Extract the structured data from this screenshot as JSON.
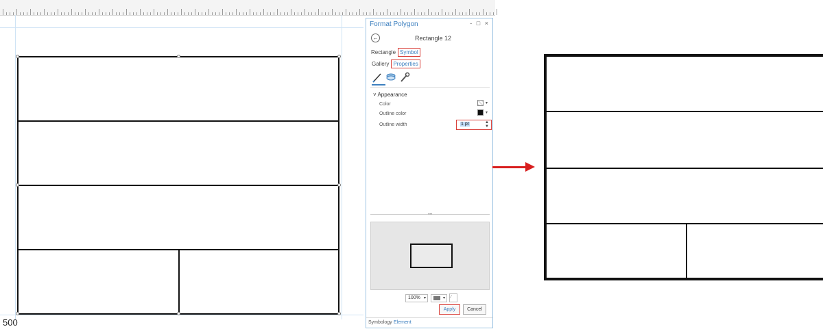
{
  "ruler": {
    "numbers": [
      "",
      "",
      "",
      "",
      "",
      "",
      "",
      "",
      "",
      "",
      "",
      "",
      "",
      "",
      "",
      "",
      "",
      "",
      "",
      "",
      "",
      "",
      "",
      "",
      "",
      "",
      "",
      "",
      "",
      "",
      "",
      "",
      "",
      "",
      "",
      "",
      "",
      ""
    ]
  },
  "layout_view": {
    "scale_label": "500"
  },
  "format_panel": {
    "title": "Format Polygon",
    "window_controls": "- □ ×",
    "element_name": "Rectangle 12",
    "tabs_row1": [
      "Rectangle",
      "Symbol"
    ],
    "tabs_row2": [
      "Gallery",
      "Properties"
    ],
    "icon_names": [
      "pencil-icon",
      "layers-icon",
      "wrench-icon"
    ],
    "section_title": "Appearance",
    "properties": {
      "color_label": "Color",
      "outline_color_label": "Outline color",
      "outline_width_label": "Outline width",
      "outline_width_value": "1 pt"
    },
    "preview_controls": {
      "zoom": "100%"
    },
    "buttons": {
      "apply": "Apply",
      "cancel": "Cancel"
    },
    "bottom_tabs": [
      "Symbology",
      "Element"
    ]
  },
  "colors": {
    "highlight_red": "#d9403a",
    "accent_blue": "#3c7fbf",
    "arrow_red": "#d81f1f"
  }
}
